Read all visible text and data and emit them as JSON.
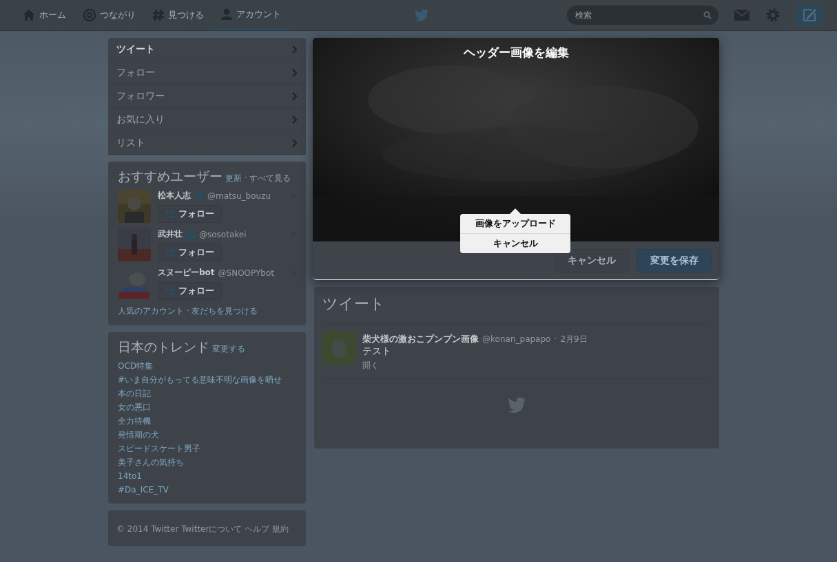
{
  "nav": {
    "items": [
      {
        "label": "ホーム",
        "selected": false
      },
      {
        "label": "つながり",
        "selected": false
      },
      {
        "label": "見つける",
        "selected": false
      },
      {
        "label": "アカウント",
        "selected": true
      }
    ],
    "search": {
      "placeholder": "検索"
    }
  },
  "profile_menu": [
    {
      "label": "ツイート",
      "selected": true
    },
    {
      "label": "フォロー",
      "selected": false
    },
    {
      "label": "フォロワー",
      "selected": false
    },
    {
      "label": "お気に入り",
      "selected": false
    },
    {
      "label": "リスト",
      "selected": false
    }
  ],
  "who_to_follow": {
    "title": "おすすめユーザー",
    "refresh": "更新",
    "separator": "·",
    "view_all": "すべて見る",
    "users": [
      {
        "name": "松本人志",
        "verified": true,
        "handle": "@matsu_bouzu",
        "follow": "フォロー"
      },
      {
        "name": "武井壮",
        "verified": true,
        "handle": "@sosotakei",
        "follow": "フォロー"
      },
      {
        "name": "スヌーピーbot",
        "verified": false,
        "handle": "@SNOOPYbot",
        "follow": "フォロー"
      }
    ],
    "footer": "人気のアカウント · 友だちを見つける"
  },
  "trends": {
    "title": "日本のトレンド",
    "change": "変更する",
    "items": [
      "OCD特集",
      "#いま自分がもってる意味不明な画像を晒せ",
      "本の日記",
      "女の悪口",
      "全力待機",
      "発情期の犬",
      "スピードスケート男子",
      "美子さんの気持ち",
      "14to1",
      "#Da_ICE_TV"
    ]
  },
  "site_footer": "© 2014 Twitter Twitterについて ヘルプ 規約",
  "timeline": {
    "title": "ツイート",
    "tweets": [
      {
        "name": "柴犬様の激おこプンプン画像",
        "handle": "@konan_papapo",
        "separator": "·",
        "time": "2月9日",
        "text": "テスト",
        "expand": "開く"
      }
    ]
  },
  "modal": {
    "title": "ヘッダー画像を編集",
    "menu": [
      "画像をアップロード",
      "キャンセル"
    ],
    "cancel": "キャンセル",
    "save": "変更を保存"
  }
}
